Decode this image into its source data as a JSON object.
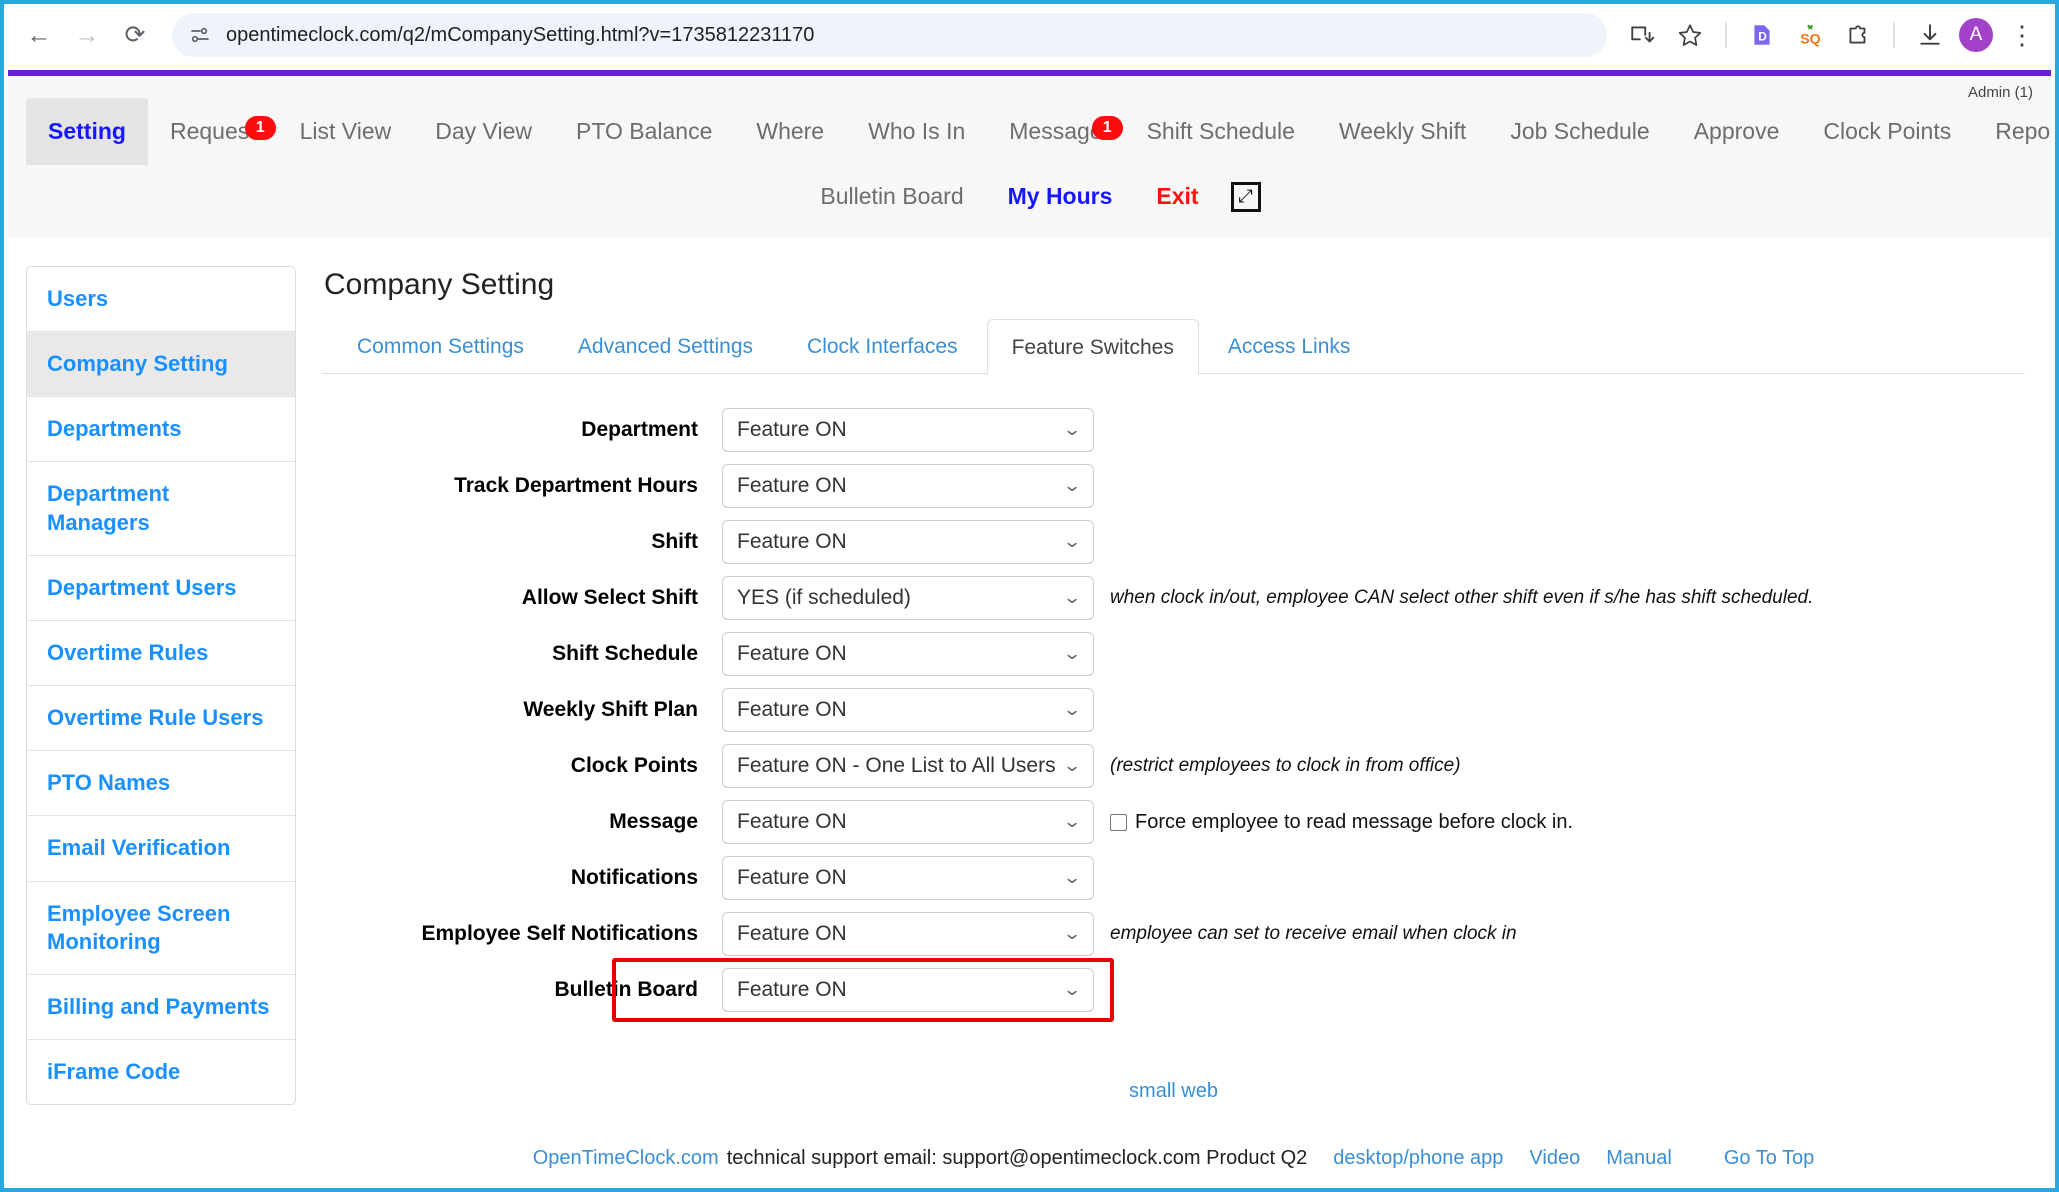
{
  "browser": {
    "url": "opentimeclock.com/q2/mCompanySetting.html?v=1735812231170",
    "back_icon": "←",
    "forward_icon": "→",
    "reload_icon": "⟳",
    "site_info_icon": "page-info-icon",
    "install_icon": "install-app-icon",
    "bookmark_icon": "☆",
    "ext_docs_icon": "D",
    "ext_squash_icon": "SQ",
    "ext_puzzle_icon": "puzzle-icon",
    "download_icon": "download-icon",
    "avatar_letter": "A",
    "menu_icon": "⋮"
  },
  "header": {
    "admin_label": "Admin (1)"
  },
  "topnav": {
    "row1": [
      {
        "label": "Setting",
        "active": true,
        "badge": null
      },
      {
        "label": "Request",
        "active": false,
        "badge": "1"
      },
      {
        "label": "List View",
        "active": false,
        "badge": null
      },
      {
        "label": "Day View",
        "active": false,
        "badge": null
      },
      {
        "label": "PTO Balance",
        "active": false,
        "badge": null
      },
      {
        "label": "Where",
        "active": false,
        "badge": null
      },
      {
        "label": "Who Is In",
        "active": false,
        "badge": null
      },
      {
        "label": "Message",
        "active": false,
        "badge": "1"
      },
      {
        "label": "Shift Schedule",
        "active": false,
        "badge": null
      },
      {
        "label": "Weekly Shift",
        "active": false,
        "badge": null
      },
      {
        "label": "Job Schedule",
        "active": false,
        "badge": null
      },
      {
        "label": "Approve",
        "active": false,
        "badge": null
      },
      {
        "label": "Clock Points",
        "active": false,
        "badge": null
      },
      {
        "label": "Reports",
        "active": false,
        "badge": null
      }
    ],
    "row2": [
      {
        "label": "Bulletin Board",
        "style": "plain"
      },
      {
        "label": "My Hours",
        "style": "blue"
      },
      {
        "label": "Exit",
        "style": "red"
      }
    ],
    "expand_icon": "⤢"
  },
  "sidebar": {
    "items": [
      {
        "label": "Users",
        "active": false
      },
      {
        "label": "Company Setting",
        "active": true
      },
      {
        "label": "Departments",
        "active": false
      },
      {
        "label": "Department Managers",
        "active": false
      },
      {
        "label": "Department Users",
        "active": false
      },
      {
        "label": "Overtime Rules",
        "active": false
      },
      {
        "label": "Overtime Rule Users",
        "active": false
      },
      {
        "label": "PTO Names",
        "active": false
      },
      {
        "label": "Email Verification",
        "active": false
      },
      {
        "label": "Employee Screen Monitoring",
        "active": false
      },
      {
        "label": "Billing and Payments",
        "active": false
      },
      {
        "label": "iFrame Code",
        "active": false
      }
    ]
  },
  "main": {
    "page_title": "Company Setting",
    "tabs": [
      {
        "label": "Common Settings",
        "active": false
      },
      {
        "label": "Advanced Settings",
        "active": false
      },
      {
        "label": "Clock Interfaces",
        "active": false
      },
      {
        "label": "Feature Switches",
        "active": true
      },
      {
        "label": "Access Links",
        "active": false
      }
    ],
    "rows": [
      {
        "label": "Department",
        "value": "Feature ON",
        "note": "",
        "note_style": "",
        "checkbox": null,
        "highlight": false
      },
      {
        "label": "Track Department Hours",
        "value": "Feature ON",
        "note": "",
        "note_style": "",
        "checkbox": null,
        "highlight": false
      },
      {
        "label": "Shift",
        "value": "Feature ON",
        "note": "",
        "note_style": "",
        "checkbox": null,
        "highlight": false
      },
      {
        "label": "Allow Select Shift",
        "value": "YES (if scheduled)",
        "note": "when clock in/out, employee CAN select other shift even if s/he has shift scheduled.",
        "note_style": "italic",
        "checkbox": null,
        "highlight": false
      },
      {
        "label": "Shift Schedule",
        "value": "Feature ON",
        "note": "",
        "note_style": "",
        "checkbox": null,
        "highlight": false
      },
      {
        "label": "Weekly Shift Plan",
        "value": "Feature ON",
        "note": "",
        "note_style": "",
        "checkbox": null,
        "highlight": false
      },
      {
        "label": "Clock Points",
        "value": "Feature ON - One List to All Users",
        "note": "(restrict employees to clock in from office)",
        "note_style": "italic",
        "checkbox": null,
        "highlight": false
      },
      {
        "label": "Message",
        "value": "Feature ON",
        "note": "",
        "note_style": "",
        "checkbox": {
          "label": "Force employee to read message before clock in.",
          "checked": false
        },
        "highlight": false
      },
      {
        "label": "Notifications",
        "value": "Feature ON",
        "note": "",
        "note_style": "",
        "checkbox": null,
        "highlight": false
      },
      {
        "label": "Employee Self Notifications",
        "value": "Feature ON",
        "note": "employee can set to receive email when clock in",
        "note_style": "italic",
        "checkbox": null,
        "highlight": false
      },
      {
        "label": "Bulletin Board",
        "value": "Feature ON",
        "note": "",
        "note_style": "",
        "checkbox": null,
        "highlight": true
      }
    ],
    "highlight_color": "#e60000"
  },
  "footer": {
    "small_web": "small web",
    "brand": "OpenTimeClock.com",
    "support_text": "technical support email: support@opentimeclock.com Product Q2",
    "links": [
      "desktop/phone app",
      "Video",
      "Manual",
      "Go To Top"
    ]
  }
}
